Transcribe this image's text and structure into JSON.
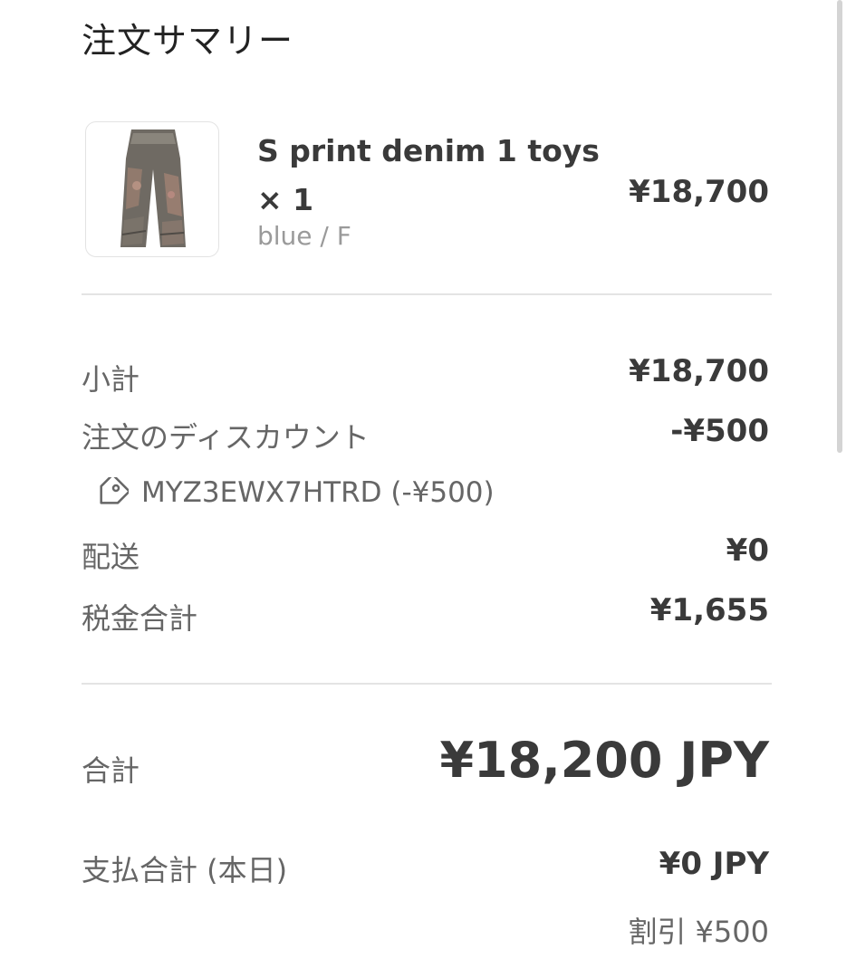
{
  "header": {
    "title": "注文サマリー"
  },
  "item": {
    "name": "S print denim 1 toys × 1",
    "variant": "blue / F",
    "price": "¥18,700",
    "thumbnail_icon": "product-image"
  },
  "summary": {
    "subtotal_label": "小計",
    "subtotal_value": "¥18,700",
    "discount_label": "注文のディスカウント",
    "discount_value": "-¥500",
    "discount_code": "MYZ3EWX7HTRD (-¥500)",
    "discount_icon": "tag-icon",
    "shipping_label": "配送",
    "shipping_value": "¥0",
    "tax_label": "税金合計",
    "tax_value": "¥1,655"
  },
  "total": {
    "label": "合計",
    "value": "¥18,200 JPY"
  },
  "payment": {
    "label": "支払合計 (本日)",
    "value": "¥0 JPY",
    "savings": "割引 ¥500"
  },
  "colors": {
    "text": "#3a3a3a",
    "muted": "#666666",
    "divider": "#e4e4e4"
  }
}
